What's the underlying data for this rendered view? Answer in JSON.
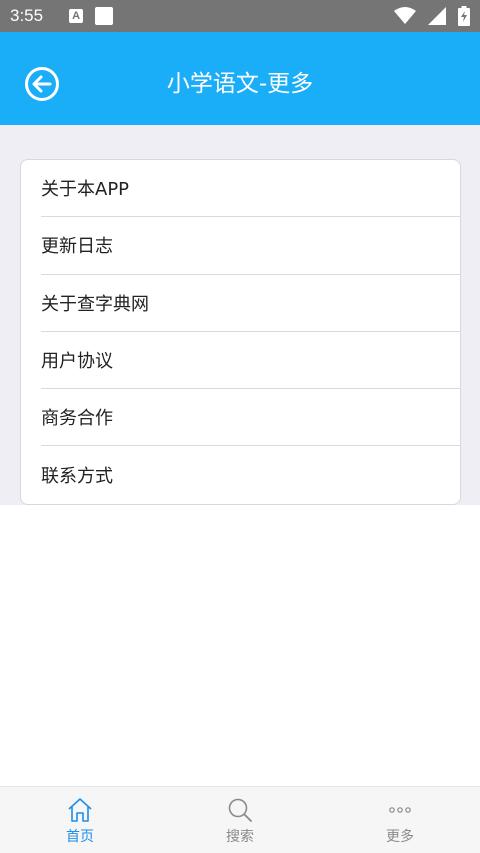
{
  "status_bar": {
    "time": "3:55",
    "notification_letter": "A"
  },
  "app_bar": {
    "title": "小学语文-更多"
  },
  "menu": {
    "items": [
      {
        "label": "关于本APP"
      },
      {
        "label": "更新日志"
      },
      {
        "label": "关于查字典网"
      },
      {
        "label": "用户协议"
      },
      {
        "label": "商务合作"
      },
      {
        "label": "联系方式"
      }
    ]
  },
  "tab_bar": {
    "tabs": [
      {
        "label": "首页",
        "icon": "home-icon",
        "active": true
      },
      {
        "label": "搜索",
        "icon": "search-icon",
        "active": false
      },
      {
        "label": "更多",
        "icon": "more-icon",
        "active": false
      }
    ]
  },
  "colors": {
    "primary": "#1aaef9",
    "active_tab": "#1f8ee8",
    "inactive_tab": "#8a8a8a",
    "content_bg": "#efeef4"
  }
}
